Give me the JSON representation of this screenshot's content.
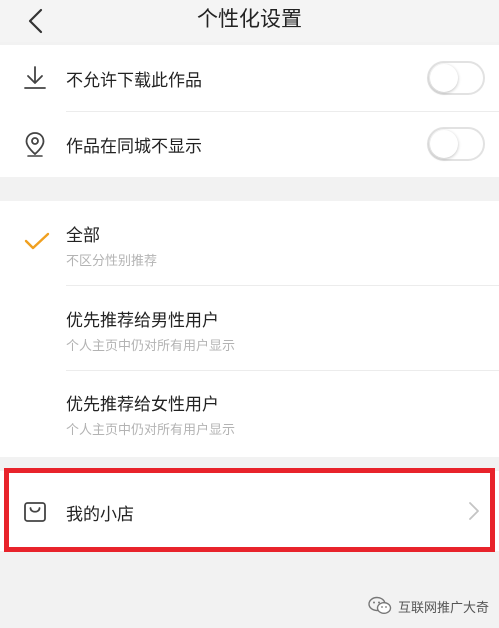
{
  "header": {
    "title": "个性化设置",
    "back_icon": "back-arrow-icon"
  },
  "privacy": {
    "download": {
      "label": "不允许下载此作品",
      "icon": "download-icon",
      "enabled": false
    },
    "same_city": {
      "label": "作品在同城不显示",
      "icon": "location-icon",
      "enabled": false
    }
  },
  "recommend": {
    "options": [
      {
        "title": "全部",
        "subtitle": "不区分性别推荐",
        "selected": true
      },
      {
        "title": "优先推荐给男性用户",
        "subtitle": "个人主页中仍对所有用户显示",
        "selected": false
      },
      {
        "title": "优先推荐给女性用户",
        "subtitle": "个人主页中仍对所有用户显示",
        "selected": false
      }
    ],
    "accent_color": "#f0a020"
  },
  "shop": {
    "label": "我的小店",
    "icon": "shopping-bag-icon"
  },
  "watermark": {
    "text": "互联网推广大奇"
  },
  "colors": {
    "highlight": "#e8232b",
    "background": "#f2f2f2"
  }
}
